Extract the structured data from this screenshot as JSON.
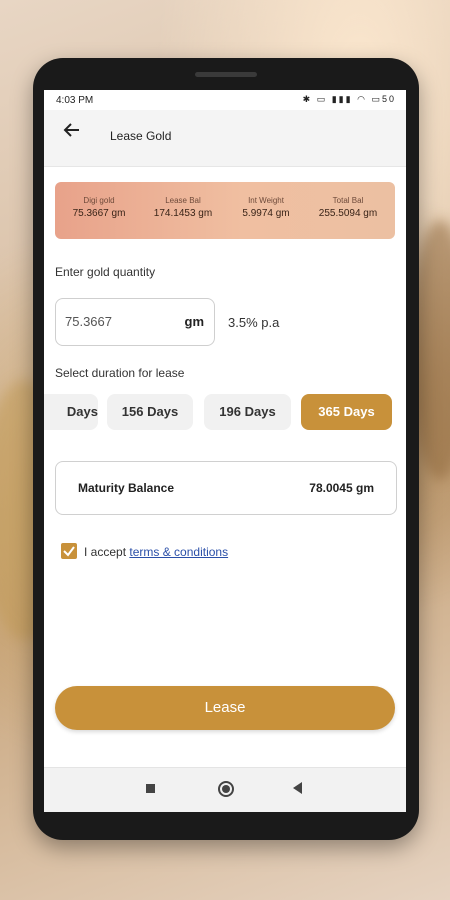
{
  "status_bar": {
    "time": "4:03 PM",
    "icons": [
      "bluetooth-icon",
      "vibrate-icon",
      "signal-icon",
      "wifi-icon",
      "battery-icon"
    ],
    "battery": "50"
  },
  "app_bar": {
    "title": "Lease Gold",
    "back_icon": "arrow-left-icon"
  },
  "summary": {
    "digi_gold_label": "Digi gold",
    "digi_gold_value": "75.3667 gm",
    "lease_bal_label": "Lease Bal",
    "lease_bal_value": "174.1453 gm",
    "int_weight_label": "Int Weight",
    "int_weight_value": "5.9974 gm",
    "total_bal_label": "Total Bal",
    "total_bal_value": "255.5094 gm"
  },
  "quantity": {
    "label": "Enter gold quantity",
    "value": "75.3667",
    "unit": "gm",
    "rate": "3.5% p.a"
  },
  "duration": {
    "label": "Select duration for lease",
    "options": [
      "Days",
      "156 Days",
      "196 Days",
      "365 Days"
    ],
    "selected": "365 Days"
  },
  "maturity": {
    "label": "Maturity Balance",
    "value": "78.0045 gm"
  },
  "terms": {
    "prefix": "I accept",
    "link": "terms & conditions",
    "checked": true
  },
  "lease_button": "Lease",
  "colors": {
    "accent": "#c8913a",
    "summary_start": "#e8a28a",
    "summary_end": "#ecc0a2",
    "link": "#2a4fa8"
  }
}
